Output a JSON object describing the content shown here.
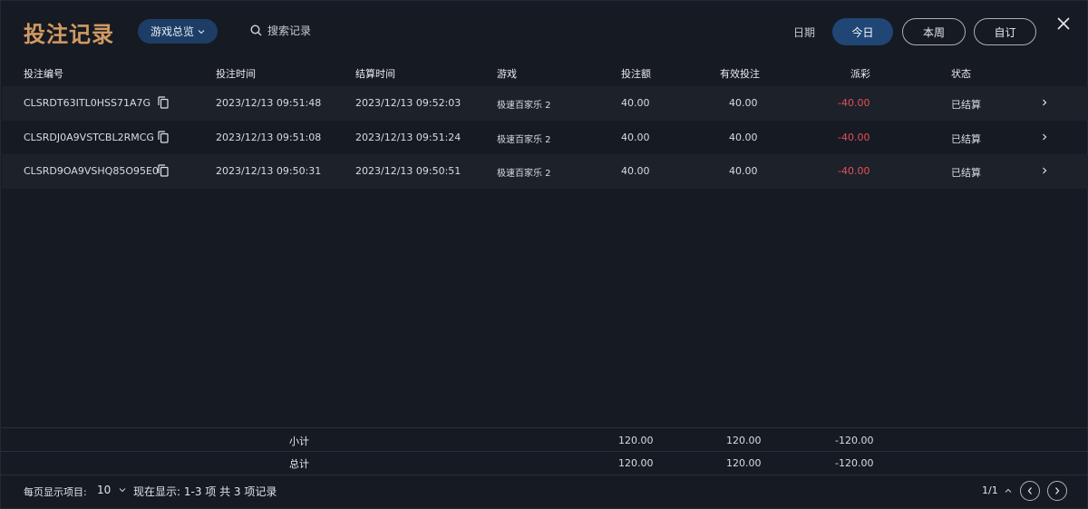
{
  "header": {
    "title": "投注记录",
    "game_filter": "游戏总览",
    "search_placeholder": "搜索记录",
    "date_label": "日期",
    "date_options": [
      "今日",
      "本周",
      "自订"
    ],
    "active_date": "今日"
  },
  "table": {
    "columns": [
      "投注编号",
      "投注时间",
      "结算时间",
      "游戏",
      "投注额",
      "有效投注",
      "派彩",
      "状态"
    ],
    "rows": [
      {
        "id": "CLSRDT63ITL0HSS71A7G",
        "bet_time": "2023/12/13 09:51:48",
        "settle_time": "2023/12/13 09:52:03",
        "game": "极速百家乐 2",
        "amount": "40.00",
        "valid": "40.00",
        "payout": "-40.00",
        "status": "已结算"
      },
      {
        "id": "CLSRDJ0A9VSTCBL2RMCG",
        "bet_time": "2023/12/13 09:51:08",
        "settle_time": "2023/12/13 09:51:24",
        "game": "极速百家乐 2",
        "amount": "40.00",
        "valid": "40.00",
        "payout": "-40.00",
        "status": "已结算"
      },
      {
        "id": "CLSRD9OA9VSHQ85O95E0",
        "bet_time": "2023/12/13 09:50:31",
        "settle_time": "2023/12/13 09:50:51",
        "game": "极速百家乐 2",
        "amount": "40.00",
        "valid": "40.00",
        "payout": "-40.00",
        "status": "已结算"
      }
    ]
  },
  "summary": {
    "subtotal": {
      "label": "小计",
      "amount": "120.00",
      "valid": "120.00",
      "payout": "-120.00"
    },
    "total": {
      "label": "总计",
      "amount": "120.00",
      "valid": "120.00",
      "payout": "-120.00"
    }
  },
  "footer": {
    "per_page_label": "每页显示项目:",
    "per_page_value": "10",
    "showing_text": "现在显示: 1-3 项 共 3 项记录",
    "page_indicator": "1/1"
  },
  "colors": {
    "title": "#d19a62",
    "accent": "#1f4675",
    "negative": "#e2525b",
    "background": "#161a22"
  }
}
